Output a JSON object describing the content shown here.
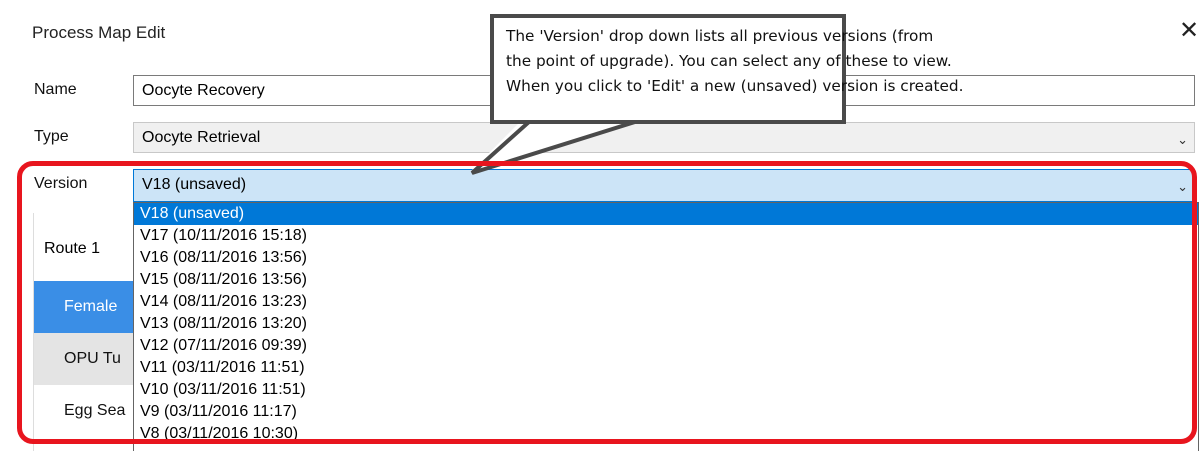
{
  "dialog": {
    "title": "Process Map Edit",
    "close_symbol": "✕"
  },
  "form": {
    "name_label": "Name",
    "name_value": "Oocyte Recovery",
    "type_label": "Type",
    "type_value": "Oocyte Retrieval",
    "version_label": "Version",
    "version_value": "V18 (unsaved)"
  },
  "version_options": [
    "V18 (unsaved)",
    "V17 (10/11/2016 15:18)",
    "V16 (08/11/2016 13:56)",
    "V15 (08/11/2016 13:56)",
    "V14 (08/11/2016 13:23)",
    "V13 (08/11/2016 13:20)",
    "V12 (07/11/2016 09:39)",
    "V11 (03/11/2016 11:51)",
    "V10 (03/11/2016 11:51)",
    "V9 (03/11/2016 11:17)",
    "V8 (03/11/2016 10:30)"
  ],
  "selected_option_index": 0,
  "routes": {
    "route_label": "Route 1",
    "steps": [
      "Female",
      "OPU Tu",
      "Egg Sea"
    ]
  },
  "callout": {
    "lines": [
      "The 'Version' drop down lists all previous versions (from",
      "the point of upgrade). You can select any of these to view.",
      "When you click to 'Edit' a new (unsaved) version is created."
    ]
  },
  "colors": {
    "selection": "#0078d7",
    "highlight_border": "#e8151e",
    "top_accent": "#2b73c9",
    "route_selected": "#3a8ee6",
    "route_shaded": "#e4e4e4"
  },
  "icons": {
    "chevron": "chevron-down-icon",
    "close": "close-icon"
  }
}
